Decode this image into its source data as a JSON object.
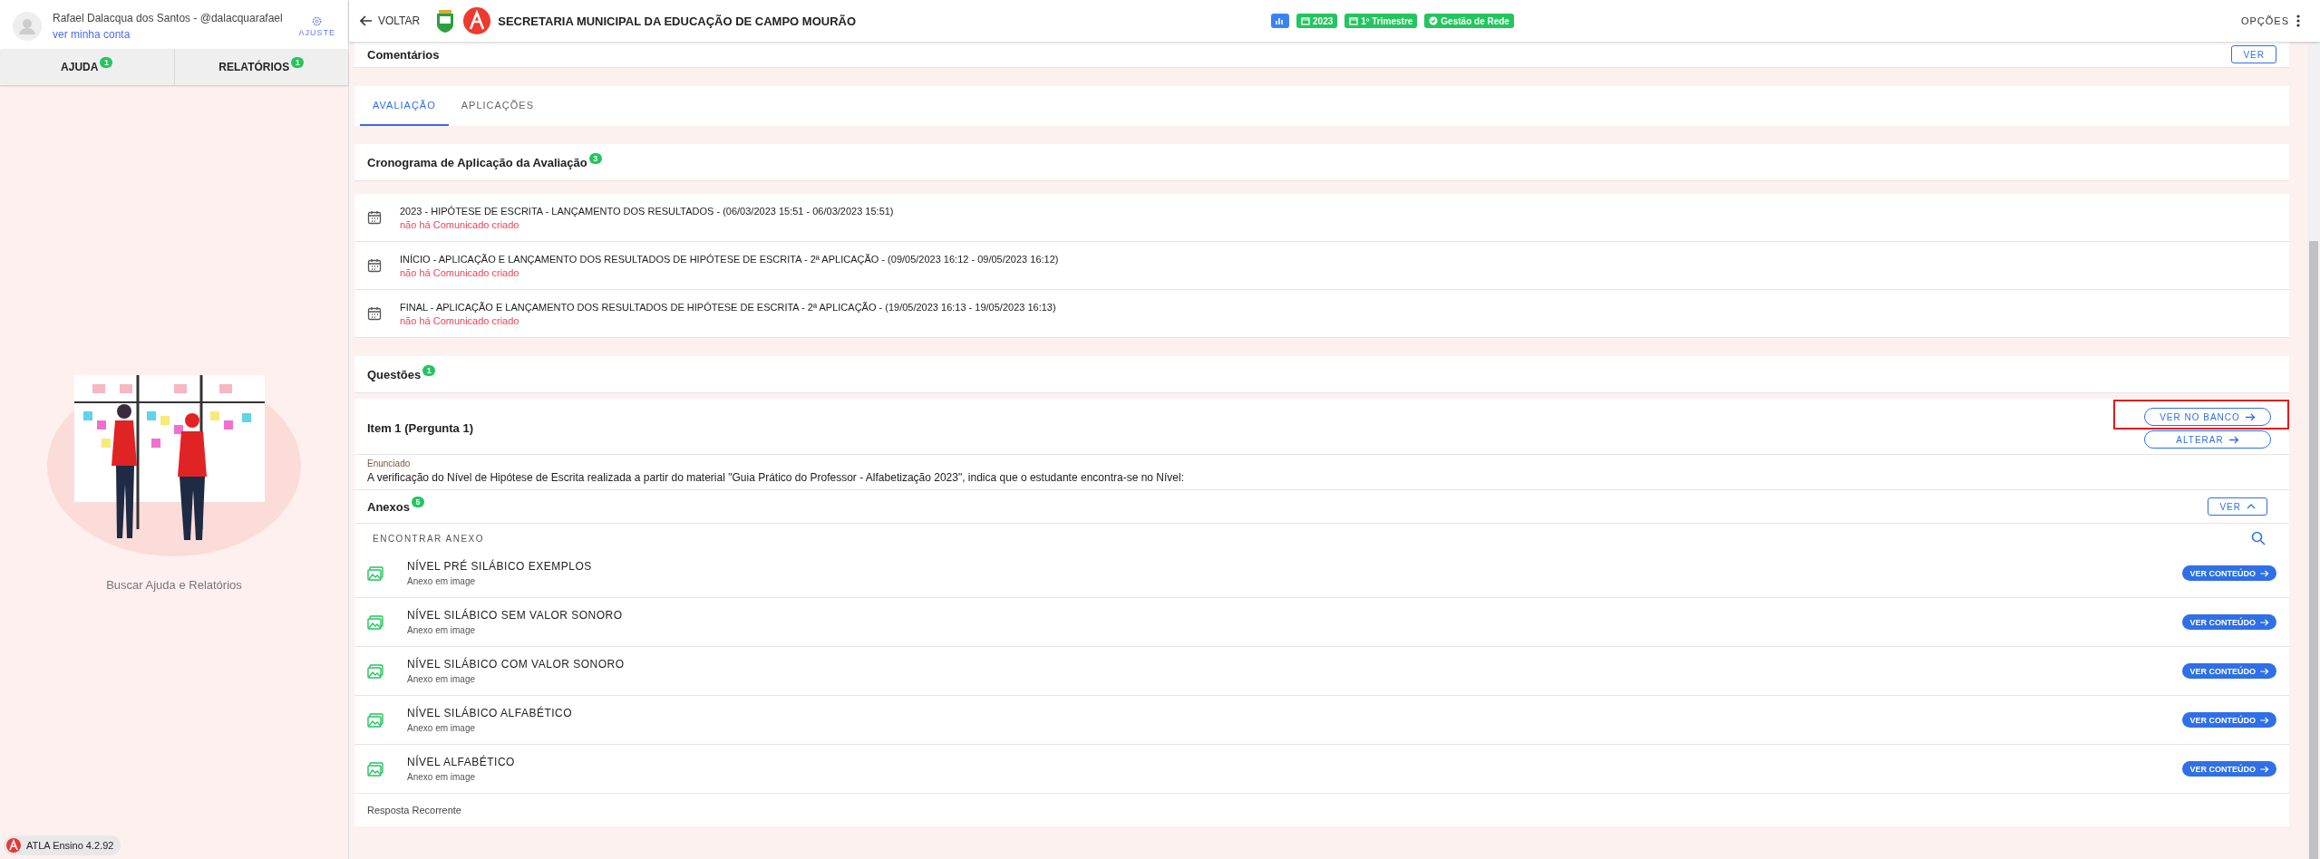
{
  "sidebar": {
    "user_name": "Rafael Dalacqua dos Santos - @dalacquarafael",
    "account_link": "ver minha conta",
    "settings_button": "AJUSTE",
    "tabs": [
      {
        "label": "AJUDA",
        "badge": "1"
      },
      {
        "label": "RELATÓRIOS",
        "badge": "1"
      }
    ],
    "empty_state": "Buscar Ajuda e Relatórios",
    "version": "ATLA Ensino 4.2.92"
  },
  "topbar": {
    "back": "VOLTAR",
    "title": "SECRETARIA MUNICIPAL DA EDUCAÇÃO DE CAMPO MOURÃO",
    "chips": [
      {
        "kind": "calendar",
        "label": "2023"
      },
      {
        "kind": "calendar",
        "label": "1º Trimestre"
      },
      {
        "kind": "check",
        "label": "Gestão de Rede"
      }
    ],
    "options": "OPÇÕES"
  },
  "comments": {
    "title": "Comentários",
    "button": "VER"
  },
  "tabs": [
    {
      "label": "AVALIAÇÃO",
      "selected": true
    },
    {
      "label": "APLICAÇÕES",
      "selected": false
    }
  ],
  "schedule": {
    "title": "Cronograma de Aplicação da Avaliação",
    "count": "3",
    "items": [
      {
        "title": "2023 - HIPÓTESE DE ESCRITA - LANÇAMENTO DOS RESULTADOS - (06/03/2023 15:51 - 06/03/2023 15:51)",
        "note": "não há Comunicado criado"
      },
      {
        "title": "INÍCIO - APLICAÇÃO E LANÇAMENTO DOS RESULTADOS DE HIPÓTESE DE ESCRITA - 2ª APLICAÇÃO - (09/05/2023 16:12 - 09/05/2023 16:12)",
        "note": "não há Comunicado criado"
      },
      {
        "title": "FINAL - APLICAÇÃO E LANÇAMENTO DOS RESULTADOS DE HIPÓTESE DE ESCRITA - 2ª APLICAÇÃO - (19/05/2023 16:13 - 19/05/2023 16:13)",
        "note": "não há Comunicado criado"
      }
    ]
  },
  "questions": {
    "title": "Questões",
    "count": "1",
    "item_title": "Item 1 (Pergunta 1)",
    "buttons": [
      "VER NO BANCO",
      "ALTERAR"
    ],
    "highlight_frame": true,
    "statement_label": "Enunciado",
    "statement": "A verificação do Nível de Hipótese de Escrita realizada a partir do material \"Guia Prático do Professor - Alfabetização 2023\", indica que o estudante encontra-se no Nível:"
  },
  "annexes": {
    "title": "Anexos",
    "count": "5",
    "toggle": "VER",
    "search_label": "ENCONTRAR ANEXO",
    "items": [
      {
        "name": "NÍVEL PRÉ SILÁBICO EXEMPLOS",
        "type": "Anexo em image",
        "button": "VER CONTEÚDO"
      },
      {
        "name": "NÍVEL SILÁBICO SEM VALOR SONORO",
        "type": "Anexo em image",
        "button": "VER CONTEÚDO"
      },
      {
        "name": "NÍVEL SILÁBICO COM VALOR SONORO",
        "type": "Anexo em image",
        "button": "VER CONTEÚDO"
      },
      {
        "name": "NÍVEL SILÁBICO ALFABÉTICO",
        "type": "Anexo em image",
        "button": "VER CONTEÚDO"
      },
      {
        "name": "NÍVEL ALFABÉTICO",
        "type": "Anexo em image",
        "button": "VER CONTEÚDO"
      }
    ],
    "footer": "Resposta Recorrente"
  }
}
